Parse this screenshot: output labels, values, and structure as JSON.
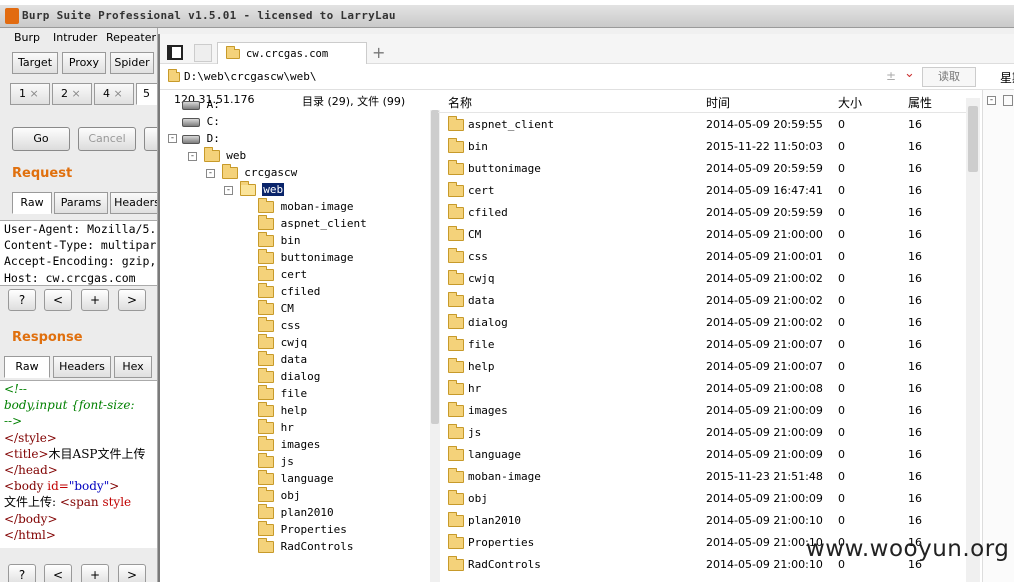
{
  "title_bar": {
    "text": "Burp Suite Professional v1.5.01 - licensed to LarryLau"
  },
  "burp": {
    "menu": [
      "Burp",
      "Intruder",
      "Repeater"
    ],
    "main_tabs": [
      "Target",
      "Proxy",
      "Spider"
    ],
    "sub_tabs": [
      "1",
      "2",
      "4",
      "5"
    ],
    "close_glyph": "×",
    "go_label": "Go",
    "cancel_label": "Cancel",
    "request_label": "Request",
    "request_tabs": [
      "Raw",
      "Params",
      "Headers"
    ],
    "request_lines": [
      "User-Agent: Mozilla/5.",
      "Content-Type: multipar",
      "Accept-Encoding: gzip,",
      "Host: cw.crcgas.com"
    ],
    "nav_buttons": [
      "?",
      "<",
      "+",
      ">"
    ],
    "response_label": "Response",
    "response_tabs": [
      "Raw",
      "Headers",
      "Hex"
    ]
  },
  "response_lines": [
    {
      "kind": "cm",
      "text": "<!--"
    },
    {
      "kind": "cm",
      "text": "body,input {font-size:"
    },
    {
      "kind": "cm",
      "text": "-->"
    },
    {
      "kind": "tag",
      "text": "</style>"
    },
    {
      "kind": "mix",
      "tag1": "<title>",
      "text": "木目ASP文件上传"
    },
    {
      "kind": "tag",
      "text": "</head>"
    },
    {
      "kind": "attr",
      "tag1": "<body ",
      "attr": "id=",
      "val": "\"body\"",
      "tag2": ">"
    },
    {
      "kind": "mix2",
      "text": "文件上传: ",
      "tag1": "<span ",
      "attr": "style"
    },
    {
      "kind": "tag",
      "text": "</body>"
    },
    {
      "kind": "tag",
      "text": "</html>"
    }
  ],
  "filemgr": {
    "tab_title": "cw.crcgas.com",
    "add_tab": "+",
    "path": "D:\\web\\crcgascw\\web\\",
    "read_btn": "读取",
    "right_label": "星期",
    "ip": "120.31.51.176",
    "summary": "目录 (29), 文件 (99)",
    "columns": {
      "name": "名称",
      "time": "时间",
      "size": "大小",
      "attr": "属性"
    },
    "tree": {
      "drives": [
        "A:",
        "C:",
        "D:"
      ],
      "web": "web",
      "crcgascw": "crcgascw",
      "selected": "web",
      "folders": [
        "moban-image",
        "aspnet_client",
        "bin",
        "buttonimage",
        "cert",
        "cfiled",
        "CM",
        "css",
        "cwjq",
        "data",
        "dialog",
        "file",
        "help",
        "hr",
        "images",
        "js",
        "language",
        "obj",
        "plan2010",
        "Properties",
        "RadControls"
      ]
    },
    "rows": [
      {
        "name": "aspnet_client",
        "time": "2014-05-09 20:59:55",
        "size": "0",
        "attr": "16"
      },
      {
        "name": "bin",
        "time": "2015-11-22 11:50:03",
        "size": "0",
        "attr": "16"
      },
      {
        "name": "buttonimage",
        "time": "2014-05-09 20:59:59",
        "size": "0",
        "attr": "16"
      },
      {
        "name": "cert",
        "time": "2014-05-09 16:47:41",
        "size": "0",
        "attr": "16"
      },
      {
        "name": "cfiled",
        "time": "2014-05-09 20:59:59",
        "size": "0",
        "attr": "16"
      },
      {
        "name": "CM",
        "time": "2014-05-09 21:00:00",
        "size": "0",
        "attr": "16"
      },
      {
        "name": "css",
        "time": "2014-05-09 21:00:01",
        "size": "0",
        "attr": "16"
      },
      {
        "name": "cwjq",
        "time": "2014-05-09 21:00:02",
        "size": "0",
        "attr": "16"
      },
      {
        "name": "data",
        "time": "2014-05-09 21:00:02",
        "size": "0",
        "attr": "16"
      },
      {
        "name": "dialog",
        "time": "2014-05-09 21:00:02",
        "size": "0",
        "attr": "16"
      },
      {
        "name": "file",
        "time": "2014-05-09 21:00:07",
        "size": "0",
        "attr": "16"
      },
      {
        "name": "help",
        "time": "2014-05-09 21:00:07",
        "size": "0",
        "attr": "16"
      },
      {
        "name": "hr",
        "time": "2014-05-09 21:00:08",
        "size": "0",
        "attr": "16"
      },
      {
        "name": "images",
        "time": "2014-05-09 21:00:09",
        "size": "0",
        "attr": "16"
      },
      {
        "name": "js",
        "time": "2014-05-09 21:00:09",
        "size": "0",
        "attr": "16"
      },
      {
        "name": "language",
        "time": "2014-05-09 21:00:09",
        "size": "0",
        "attr": "16"
      },
      {
        "name": "moban-image",
        "time": "2015-11-23 21:51:48",
        "size": "0",
        "attr": "16"
      },
      {
        "name": "obj",
        "time": "2014-05-09 21:00:09",
        "size": "0",
        "attr": "16"
      },
      {
        "name": "plan2010",
        "time": "2014-05-09 21:00:10",
        "size": "0",
        "attr": "16"
      },
      {
        "name": "Properties",
        "time": "2014-05-09 21:00:10",
        "size": "0",
        "attr": "16"
      },
      {
        "name": "RadControls",
        "time": "2014-05-09 21:00:10",
        "size": "0",
        "attr": "16"
      }
    ]
  },
  "watermark": "www.wooyun.org",
  "colors": {
    "accent": "#e0700e",
    "folder": "#f4d27a",
    "selection": "#0a246a"
  }
}
